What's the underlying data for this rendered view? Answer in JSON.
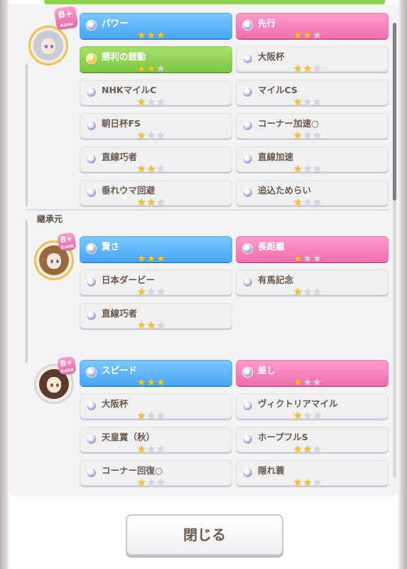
{
  "parents": [
    {
      "rank": "B+",
      "rank_caption": "RANK",
      "skills": [
        {
          "name": "パワー",
          "stars": 3,
          "color": "blue"
        },
        {
          "name": "先行",
          "stars": 2,
          "color": "pink"
        },
        {
          "name": "勝利の鼓動",
          "stars": 2,
          "color": "green"
        },
        {
          "name": "大阪杯",
          "stars": 2,
          "color": "white"
        },
        {
          "name": "NHKマイルC",
          "stars": 1,
          "color": "white"
        },
        {
          "name": "マイルCS",
          "stars": 1,
          "color": "white"
        },
        {
          "name": "朝日杯FS",
          "stars": 1,
          "color": "white"
        },
        {
          "name": "コーナー加速○",
          "stars": 1,
          "color": "white"
        },
        {
          "name": "直線巧者",
          "stars": 2,
          "color": "white"
        },
        {
          "name": "直線加速",
          "stars": 1,
          "color": "white"
        },
        {
          "name": "垂れウマ回避",
          "stars": 2,
          "color": "white"
        },
        {
          "name": "追込ためらい",
          "stars": 1,
          "color": "white"
        }
      ]
    },
    {
      "rank": "B+",
      "rank_caption": "RANK",
      "skills": [
        {
          "name": "賢さ",
          "stars": 3,
          "color": "blue"
        },
        {
          "name": "長距離",
          "stars": 1,
          "color": "pink"
        },
        {
          "name": "日本ダービー",
          "stars": 1,
          "color": "white"
        },
        {
          "name": "有馬記念",
          "stars": 1,
          "color": "white"
        },
        {
          "name": "直線巧者",
          "stars": 2,
          "color": "white"
        }
      ]
    },
    {
      "rank": "B+",
      "rank_caption": "RANK",
      "skills": [
        {
          "name": "スピード",
          "stars": 3,
          "color": "blue"
        },
        {
          "name": "差し",
          "stars": 1,
          "color": "pink"
        },
        {
          "name": "大阪杯",
          "stars": 1,
          "color": "white"
        },
        {
          "name": "ヴィクトリアマイル",
          "stars": 1,
          "color": "white"
        },
        {
          "name": "天皇賞（秋）",
          "stars": 1,
          "color": "white"
        },
        {
          "name": "ホープフルS",
          "stars": 2,
          "color": "white"
        },
        {
          "name": "コーナー回復○",
          "stars": 1,
          "color": "white"
        },
        {
          "name": "隠れ蓑",
          "stars": 2,
          "color": "white"
        }
      ]
    }
  ],
  "section_label": "継承元",
  "close_button": "閉じる",
  "colors": {
    "blue": "#4aa7f3",
    "pink": "#f06fae",
    "green": "#7cc846",
    "star": "#f5c42c"
  }
}
